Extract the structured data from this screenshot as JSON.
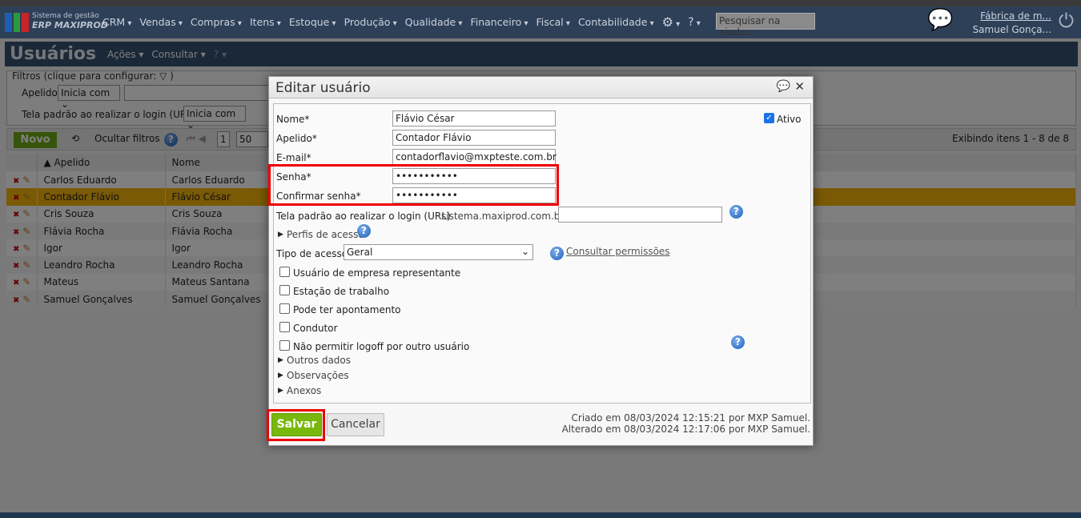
{
  "nav": {
    "brand_line1": "Sistema de gestão",
    "brand_line2": "ERP MAXIPROD",
    "menu": [
      "CRM",
      "Vendas",
      "Compras",
      "Itens",
      "Estoque",
      "Produção",
      "Qualidade",
      "Financeiro",
      "Fiscal",
      "Contabilidade"
    ],
    "search_placeholder": "Pesquisar na ajuda...",
    "company": "Fábrica de m...",
    "user": "Samuel Gonça..."
  },
  "page": {
    "title": "Usuários",
    "menu": [
      "Ações",
      "Consultar"
    ],
    "filters_legend": "Filtros (clique para configurar:",
    "filter1_label": "Apelido",
    "filter1_op": "Inicia com",
    "filter2_label": "Tela padrão ao realizar o login (URL)",
    "filter2_op": "Inicia com"
  },
  "toolbar": {
    "new": "Novo",
    "hide_filters": "Ocultar filtros",
    "page": "1",
    "page_size": "50",
    "showing": "Exibindo itens 1 - 8 de 8"
  },
  "table": {
    "headers": [
      "Apelido",
      "Nome"
    ],
    "rows": [
      [
        "Carlos Eduardo",
        "Carlos Eduardo"
      ],
      [
        "Contador Flávio",
        "Flávio César"
      ],
      [
        "Cris Souza",
        "Cris Souza"
      ],
      [
        "Flávia Rocha",
        "Flávia Rocha"
      ],
      [
        "Igor",
        "Igor"
      ],
      [
        "Leandro Rocha",
        "Leandro Rocha"
      ],
      [
        "Mateus",
        "Mateus Santana"
      ],
      [
        "Samuel Gonçalves",
        "Samuel Gonçalves"
      ]
    ]
  },
  "dialog": {
    "title": "Editar usuário",
    "nome_label": "Nome*",
    "nome": "Flávio César",
    "apelido_label": "Apelido*",
    "apelido": "Contador Flávio",
    "email_label": "E-mail*",
    "email": "contadorflavio@mxpteste.com.br",
    "senha_label": "Senha*",
    "senha": "•••••••••••",
    "confirmar_label": "Confirmar senha*",
    "confirmar": "•••••••••••",
    "ativo_label": "Ativo",
    "url_label": "Tela padrão ao realizar o login (URL)",
    "url_prefix": "sistema.maxiprod.com.br/",
    "url_value": "",
    "perfis": "Perfis de acesso",
    "tipo_label": "Tipo de acesso",
    "tipo": "Geral",
    "consultar": "Consultar permissões",
    "checks": [
      "Usuário de empresa representante",
      "Estação de trabalho",
      "Pode ter apontamento",
      "Condutor",
      "Não permitir logoff por outro usuário"
    ],
    "sections": [
      "Outros dados",
      "Observações",
      "Anexos"
    ],
    "save": "Salvar",
    "cancel": "Cancelar",
    "created": "Criado em 08/03/2024 12:15:21 por MXP Samuel.",
    "modified": "Alterado em 08/03/2024 12:17:06 por MXP Samuel."
  }
}
